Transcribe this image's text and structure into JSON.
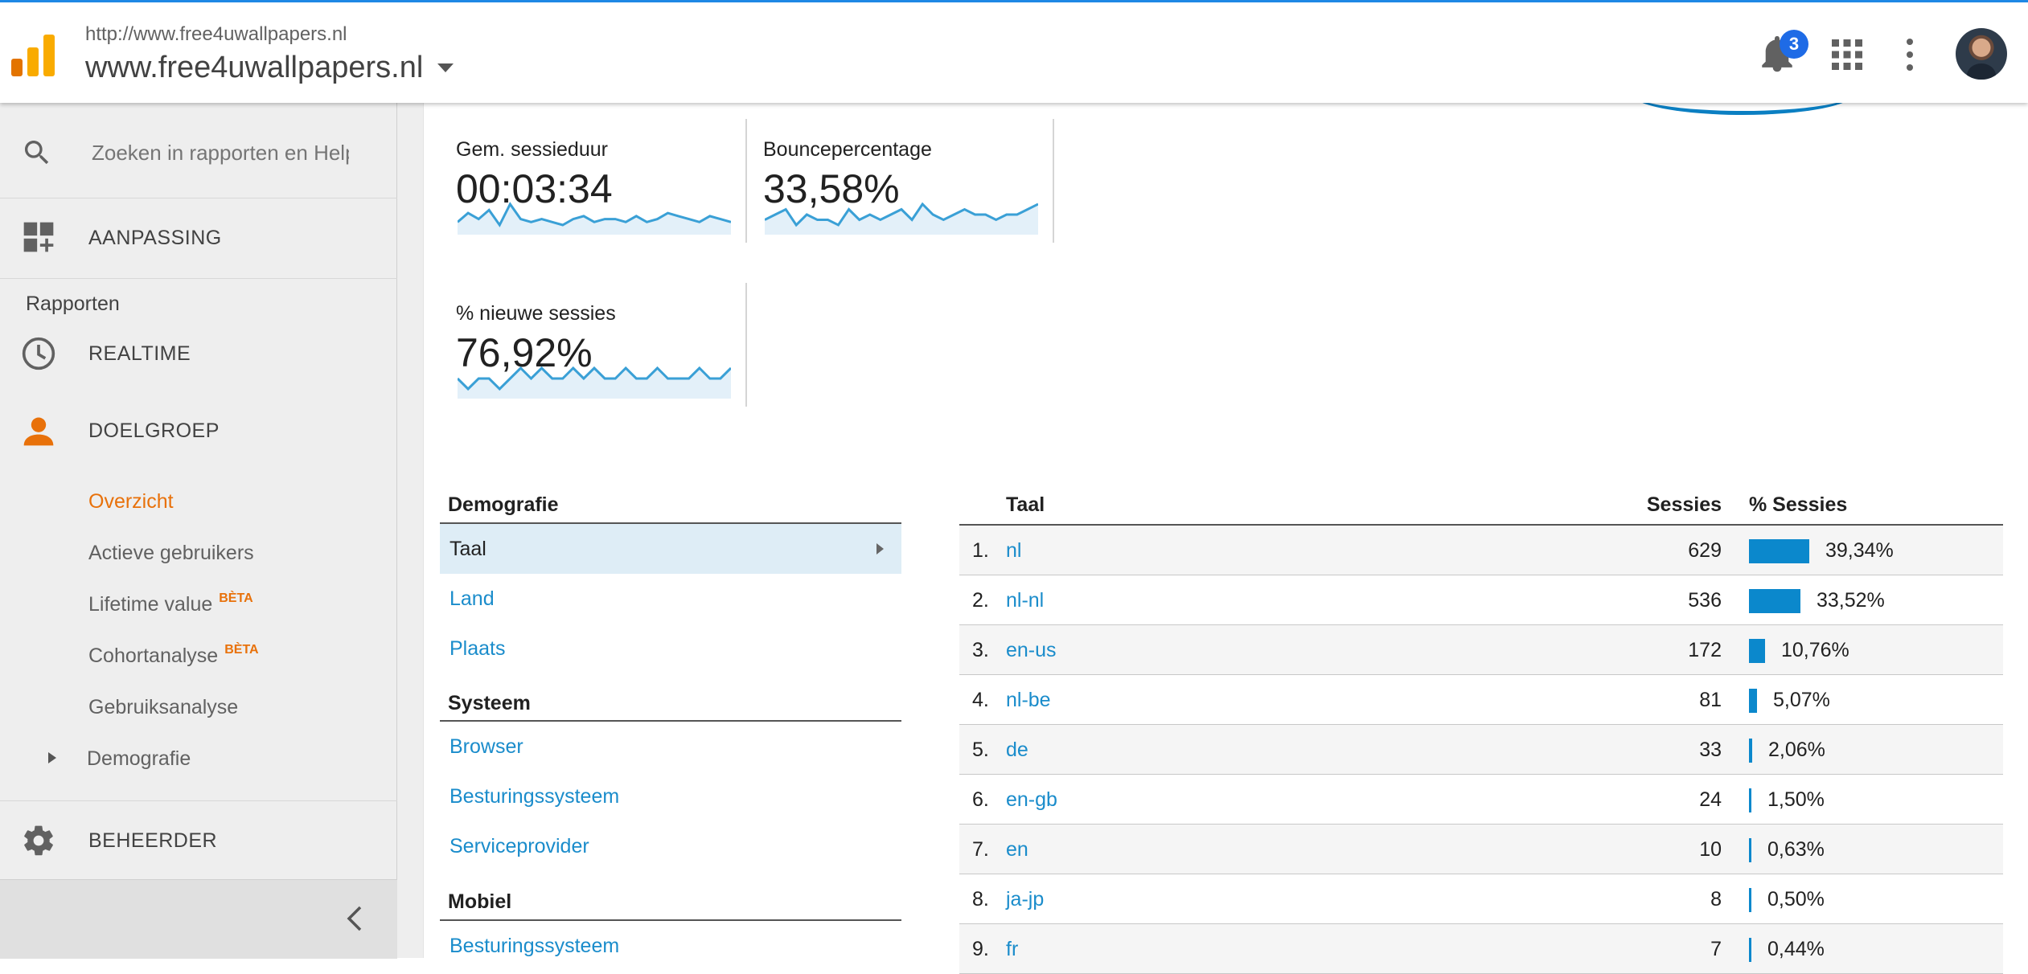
{
  "header": {
    "url": "http://www.free4uwallpapers.nl",
    "property": "www.free4uwallpapers.nl",
    "notification_count": "3",
    "colors": {
      "accent": "#1e88e5",
      "logo_orange": "#f9ab00",
      "logo_dark": "#e37400"
    },
    "icons": [
      "analytics-logo-icon",
      "bell-icon",
      "apps-grid-icon",
      "more-vert-icon",
      "avatar"
    ]
  },
  "sidebar": {
    "search_placeholder": "Zoeken in rapporten en Help",
    "customization": "AANPASSING",
    "reports_label": "Rapporten",
    "realtime": "REALTIME",
    "audience": "DOELGROEP",
    "sub_items": [
      {
        "label": "Overzicht",
        "active": true,
        "beta": ""
      },
      {
        "label": "Actieve gebruikers",
        "active": false,
        "beta": ""
      },
      {
        "label": "Lifetime value",
        "active": false,
        "beta": "BÈTA"
      },
      {
        "label": "Cohortanalyse",
        "active": false,
        "beta": "BÈTA"
      },
      {
        "label": "Gebruiksanalyse",
        "active": false,
        "beta": ""
      },
      {
        "label": "Demografie",
        "active": false,
        "beta": ""
      }
    ],
    "admin": "BEHEERDER"
  },
  "metrics": [
    {
      "label": "Gem. sessieduur",
      "value": "00:03:34",
      "spark": [
        6,
        9,
        7,
        10,
        5,
        12,
        7,
        6,
        7,
        6,
        5,
        7,
        8,
        6,
        7,
        7,
        6,
        8,
        6,
        7,
        9,
        8,
        7,
        6,
        8,
        7,
        6
      ]
    },
    {
      "label": "Bouncepercentage",
      "value": "33,58%",
      "spark": [
        8,
        9,
        10,
        7,
        9,
        8,
        8,
        7,
        10,
        8,
        9,
        8,
        9,
        10,
        8,
        11,
        9,
        8,
        9,
        10,
        9,
        9,
        8,
        9,
        9,
        10,
        11
      ]
    },
    {
      "label": "% nieuwe sessies",
      "value": "76,92%",
      "spark": [
        8,
        7,
        8,
        8,
        7,
        8,
        9,
        8,
        9,
        8,
        8,
        9,
        8,
        9,
        8,
        8,
        9,
        8,
        8,
        9,
        8,
        8,
        8,
        9,
        8,
        8,
        9
      ]
    }
  ],
  "demographics": {
    "heading": "Demografie",
    "selected": "Taal",
    "items": [
      "Land",
      "Plaats"
    ],
    "system_heading": "Systeem",
    "system_items": [
      "Browser",
      "Besturingssysteem",
      "Serviceprovider"
    ],
    "mobile_heading": "Mobiel",
    "mobile_items": [
      "Besturingssysteem"
    ]
  },
  "table": {
    "headers": {
      "dimension": "Taal",
      "sessions": "Sessies",
      "percent": "% Sessies"
    },
    "rows": [
      {
        "rank": "1.",
        "lang": "nl",
        "sessions": "629",
        "pct": "39,34%",
        "fraction": 0.3934
      },
      {
        "rank": "2.",
        "lang": "nl-nl",
        "sessions": "536",
        "pct": "33,52%",
        "fraction": 0.3352
      },
      {
        "rank": "3.",
        "lang": "en-us",
        "sessions": "172",
        "pct": "10,76%",
        "fraction": 0.1076
      },
      {
        "rank": "4.",
        "lang": "nl-be",
        "sessions": "81",
        "pct": "5,07%",
        "fraction": 0.0507
      },
      {
        "rank": "5.",
        "lang": "de",
        "sessions": "33",
        "pct": "2,06%",
        "fraction": 0.0206
      },
      {
        "rank": "6.",
        "lang": "en-gb",
        "sessions": "24",
        "pct": "1,50%",
        "fraction": 0.015
      },
      {
        "rank": "7.",
        "lang": "en",
        "sessions": "10",
        "pct": "0,63%",
        "fraction": 0.0063
      },
      {
        "rank": "8.",
        "lang": "ja-jp",
        "sessions": "8",
        "pct": "0,50%",
        "fraction": 0.005
      },
      {
        "rank": "9.",
        "lang": "fr",
        "sessions": "7",
        "pct": "0,44%",
        "fraction": 0.0044
      }
    ]
  }
}
